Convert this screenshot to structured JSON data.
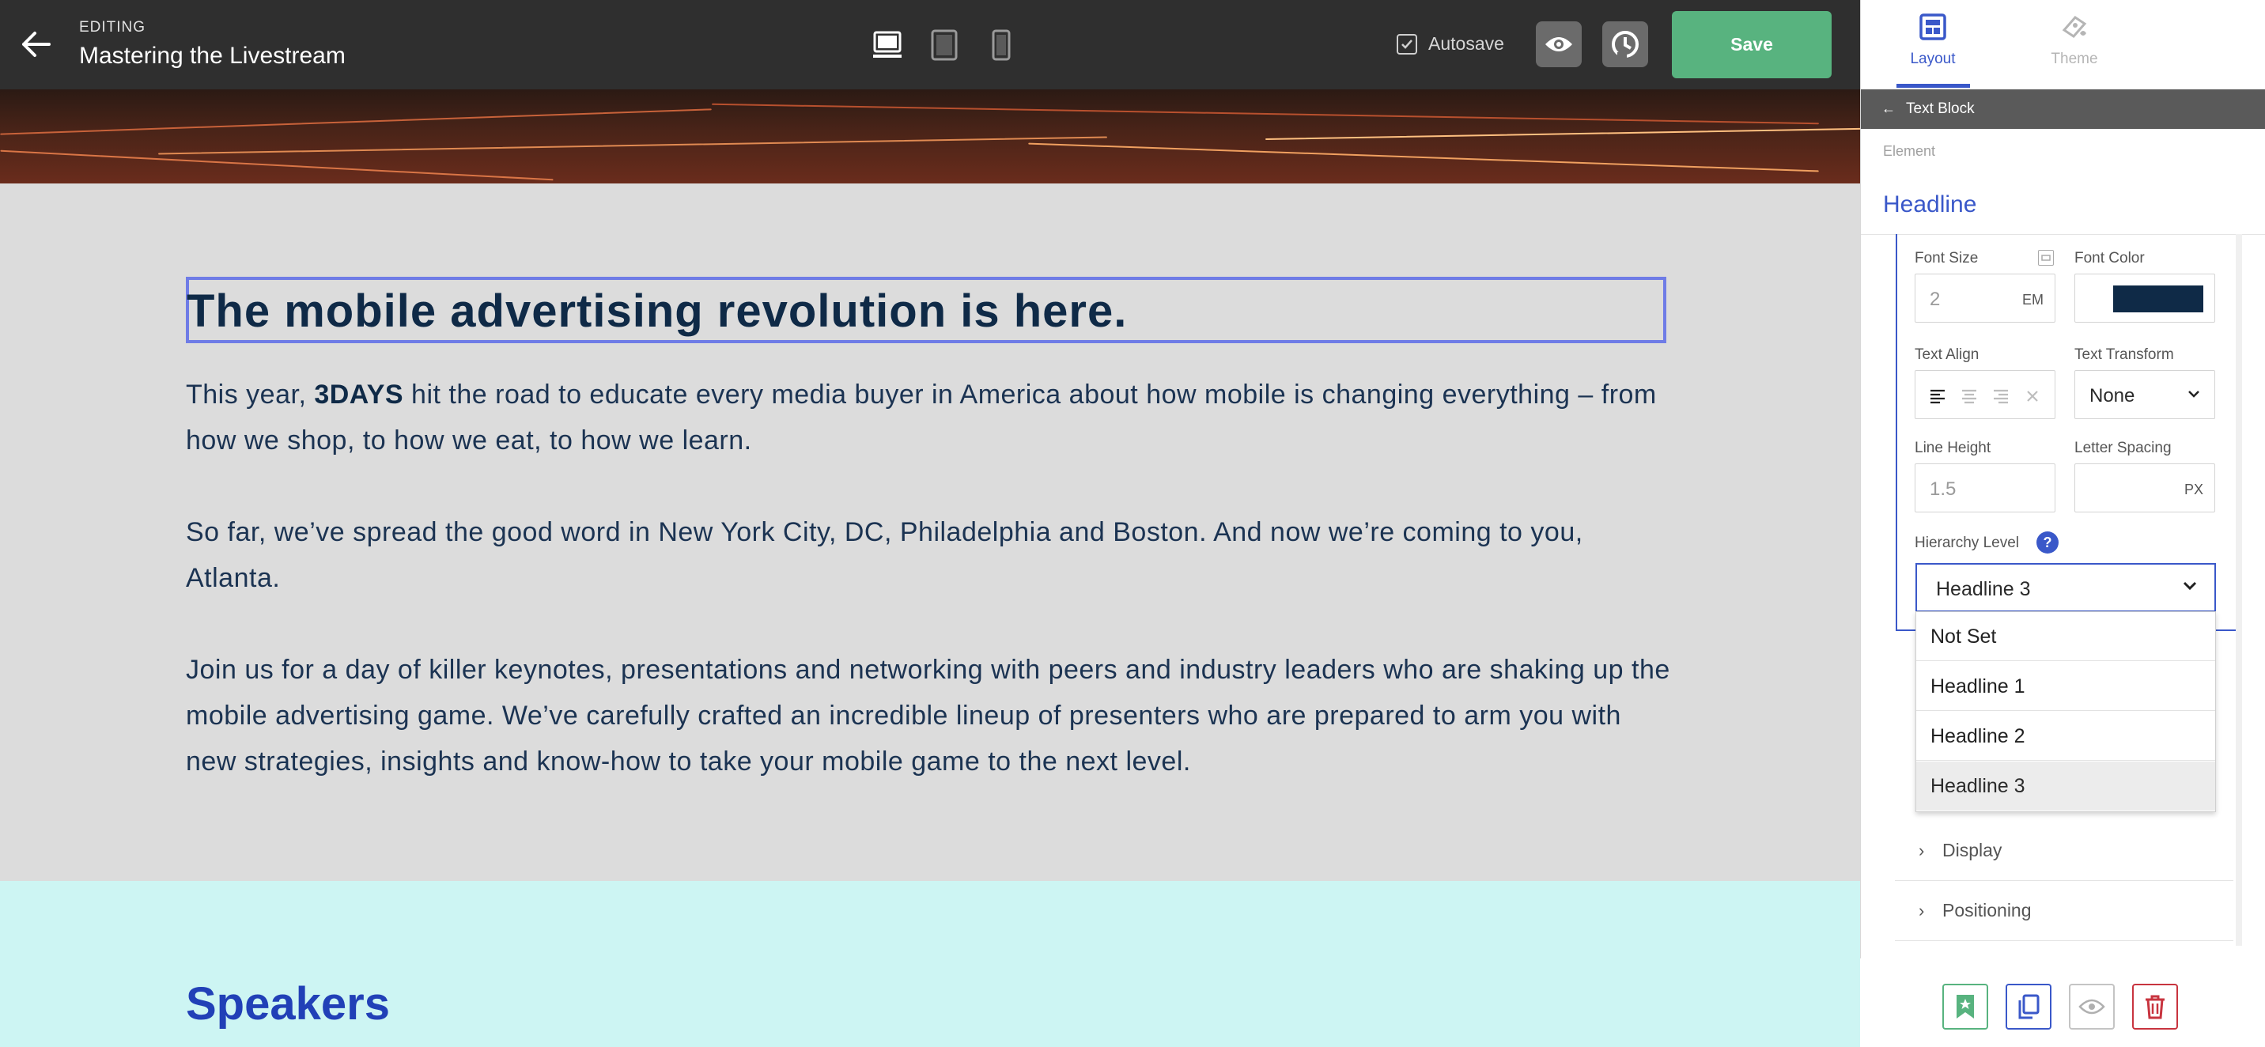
{
  "topbar": {
    "editing_label": "EDITING",
    "project_title": "Mastering the Livestream",
    "autosave_label": "Autosave",
    "save_label": "Save"
  },
  "canvas": {
    "headline": "The mobile advertising revolution is here.",
    "p1_before": "This year, ",
    "p1_brand": "3DAYS",
    "p1_after": " hit the road to educate every media buyer in America about how mobile is changing everything – from how we shop, to how we eat, to how we learn.",
    "p2": "So far, we’ve spread the good word in New York City, DC, Philadelphia and Boston. And now we’re coming to you, Atlanta.",
    "p3": "Join us for a day of killer keynotes, presentations and networking with peers and industry leaders who are shaking up the mobile advertising game. We’ve carefully crafted an incredible lineup of presenters who are prepared to arm you with new strategies, insights and know-how to take your mobile game to the next level.",
    "speakers_title": "Speakers"
  },
  "panel": {
    "tabs": {
      "layout": "Layout",
      "theme": "Theme"
    },
    "breadcrumb": "Text Block",
    "element_label": "Element",
    "section_title": "Headline",
    "font_size": {
      "label": "Font Size",
      "value": "2",
      "unit": "EM"
    },
    "font_color": {
      "label": "Font Color",
      "value": "#0f2a47"
    },
    "text_align": {
      "label": "Text Align"
    },
    "text_transform": {
      "label": "Text Transform",
      "value": "None"
    },
    "line_height": {
      "label": "Line Height",
      "value": "1.5"
    },
    "letter_spacing": {
      "label": "Letter Spacing",
      "value": "",
      "unit": "PX"
    },
    "hierarchy": {
      "label": "Hierarchy Level",
      "help": "?",
      "value": "Headline 3",
      "options": [
        "Not Set",
        "Headline 1",
        "Headline 2",
        "Headline 3"
      ]
    },
    "collapsed_sections": {
      "display": "Display",
      "positioning": "Positioning"
    }
  },
  "colors": {
    "accent": "#3a58c9",
    "save": "#58b37f",
    "topbar": "#2f2f2f",
    "speakers_band": "#cdf5f3",
    "text_dark": "#0f2a47"
  }
}
